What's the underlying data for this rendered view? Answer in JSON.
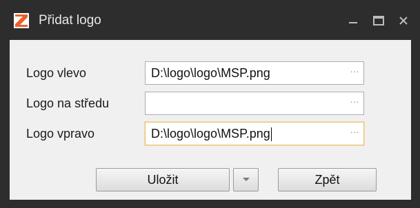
{
  "window": {
    "title": "Přidat logo",
    "controls": {
      "minimize_icon": "minimize-icon",
      "maximize_icon": "maximize-icon",
      "close_icon": "close-icon"
    },
    "app_icon": "app-logo-icon"
  },
  "form": {
    "rows": [
      {
        "label": "Logo vlevo",
        "value": "D:\\logo\\logo\\MSP.png",
        "browse": "···"
      },
      {
        "label": "Logo na středu",
        "value": "",
        "browse": "···"
      },
      {
        "label": "Logo vpravo",
        "value": "D:\\logo\\logo\\MSP.png",
        "browse": "···"
      }
    ]
  },
  "buttons": {
    "save_label": "Uložit",
    "back_label": "Zpět"
  },
  "colors": {
    "titlebar": "#2d2d2d",
    "client": "#f0f0f0",
    "focus_border": "#e2c27a",
    "icon_orange": "#e8622a"
  }
}
